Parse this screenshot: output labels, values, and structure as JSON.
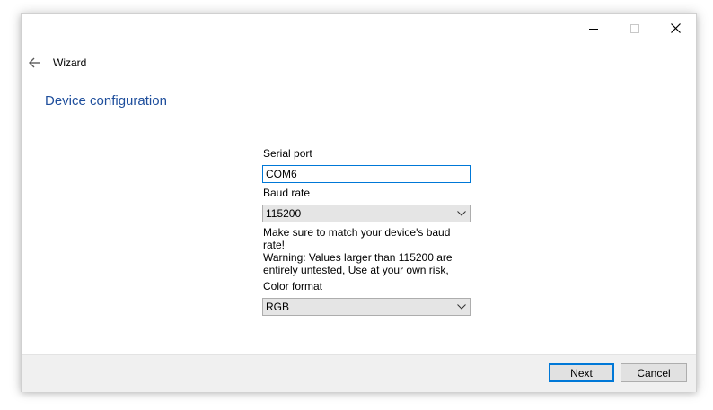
{
  "window": {
    "controls": [
      "minimize-icon",
      "maximize-icon",
      "close-icon"
    ]
  },
  "nav": {
    "back_icon": "back-arrow-icon",
    "title": "Wizard"
  },
  "page": {
    "title": "Device configuration"
  },
  "form": {
    "serial_port": {
      "label": "Serial port",
      "value": "COM6"
    },
    "baud_rate": {
      "label": "Baud rate",
      "selected": "115200",
      "help": "Make sure to match your device's baud rate!",
      "warning": "Warning: Values larger than 115200 are entirely untested, Use at your own risk,"
    },
    "color_format": {
      "label": "Color format",
      "selected": "RGB"
    }
  },
  "footer": {
    "next_label": "Next",
    "cancel_label": "Cancel"
  },
  "colors": {
    "accent": "#0078d7",
    "title_text": "#1e4e9c",
    "footer_bg": "#f0f0f0",
    "combo_bg": "#e5e5e5"
  }
}
